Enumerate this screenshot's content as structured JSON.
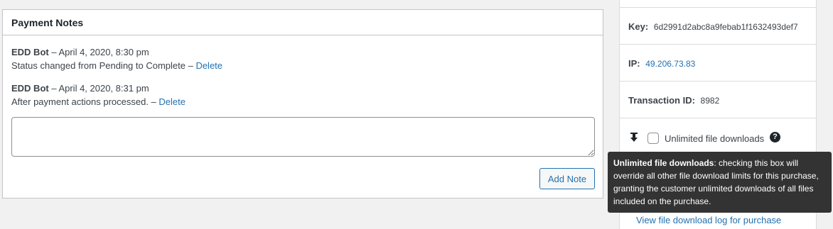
{
  "notes": {
    "title": "Payment Notes",
    "items": [
      {
        "author": "EDD Bot",
        "date": " – April 4, 2020, 8:30 pm",
        "text": "Status changed from Pending to Complete – ",
        "delete_label": "Delete"
      },
      {
        "author": "EDD Bot",
        "date": " – April 4, 2020, 8:31 pm",
        "text": "After payment actions processed. – ",
        "delete_label": "Delete"
      }
    ],
    "textarea_value": "",
    "add_note_label": "Add Note"
  },
  "sidebar": {
    "key_label": "Key:",
    "key_value": "6d2991d2abc8a9febab1f1632493def7",
    "ip_label": "IP:",
    "ip_value": "49.206.73.83",
    "transaction_label": "Transaction ID:",
    "transaction_value": "8982",
    "unlimited_label": "Unlimited file downloads",
    "help_icon": "?",
    "view_log_label": "View file download log for purchase"
  },
  "tooltip": {
    "title": "Unlimited file downloads",
    "text": ": checking this box will override all other file download limits for this purchase, granting the customer unlimited downloads of all files included on the purchase."
  },
  "colors": {
    "link": "#2271b1",
    "tooltip_bg": "#333333",
    "border": "#c3c4c7"
  }
}
